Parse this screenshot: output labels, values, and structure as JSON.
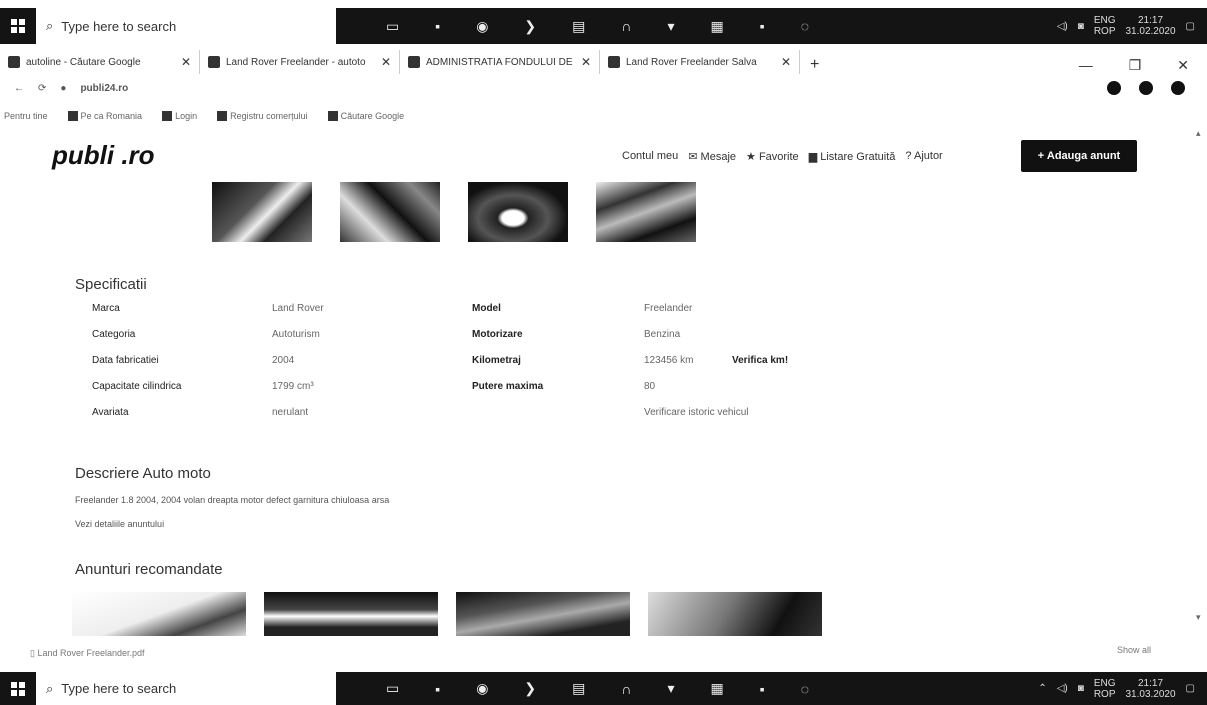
{
  "taskbar": {
    "search_placeholder": "Type here to search",
    "icons": [
      "task-view-icon",
      "store-icon",
      "chrome-icon",
      "settings-icon",
      "mail-icon",
      "headset-icon",
      "arrow-icon",
      "calculator-icon",
      "word-icon",
      "browser-icon"
    ],
    "lang_top": "ENG",
    "lang_bottom": "ROP",
    "time": "21:17",
    "date_top": "31.02.2020",
    "date_bottom": "31.03.2020"
  },
  "browser": {
    "tabs": [
      {
        "title": "autoline - Căutare Google"
      },
      {
        "title": "Land Rover Freelander - autoto"
      },
      {
        "title": "ADMINISTRATIA FONDULUI DE"
      },
      {
        "title": "Land Rover Freelander Salva"
      }
    ],
    "url_host": "publi24.ro",
    "bookmarks": [
      "Pentru tine",
      "Pe ca Romania",
      "",
      "Login",
      "Registru comerțului",
      "",
      "",
      "",
      "Căutare Google"
    ]
  },
  "site": {
    "logo": "publi   .ro",
    "nav": {
      "account": "Contul meu",
      "messages": "Mesaje",
      "favorites": "Favorite",
      "free_listing": "Listare Gratuită",
      "help": "Ajutor"
    },
    "add_button": "+ Adauga anunt"
  },
  "specs": {
    "title": "Specificatii",
    "rows": [
      {
        "label": "Marca",
        "value": "Land Rover",
        "label2": "Model",
        "value2": "Freelander",
        "extra": ""
      },
      {
        "label": "Categoria",
        "value": "Autoturism",
        "label2": "Motorizare",
        "value2": "Benzina",
        "extra": ""
      },
      {
        "label": "Data fabricatiei",
        "value": "2004",
        "label2": "Kilometraj",
        "value2": "123456 km",
        "extra": "Verifica km!"
      },
      {
        "label": "Capacitate cilindrica",
        "value": "1799 cm³",
        "label2": "Putere maxima",
        "value2": "80",
        "extra": ""
      },
      {
        "label": "Avariata",
        "value": "nerulant",
        "label2": "",
        "value2": "Verificare istoric vehicul",
        "extra": ""
      }
    ]
  },
  "description": {
    "title": "Descriere Auto moto",
    "text": "Freelander 1.8 2004, 2004 volan dreapta motor defect garnitura chiuloasa arsa",
    "more": "Vezi detaliile anuntului"
  },
  "recommended": {
    "title": "Anunturi recomandate"
  },
  "footer": {
    "download": "Land Rover Freelander.pdf",
    "show_all": "Show all"
  }
}
